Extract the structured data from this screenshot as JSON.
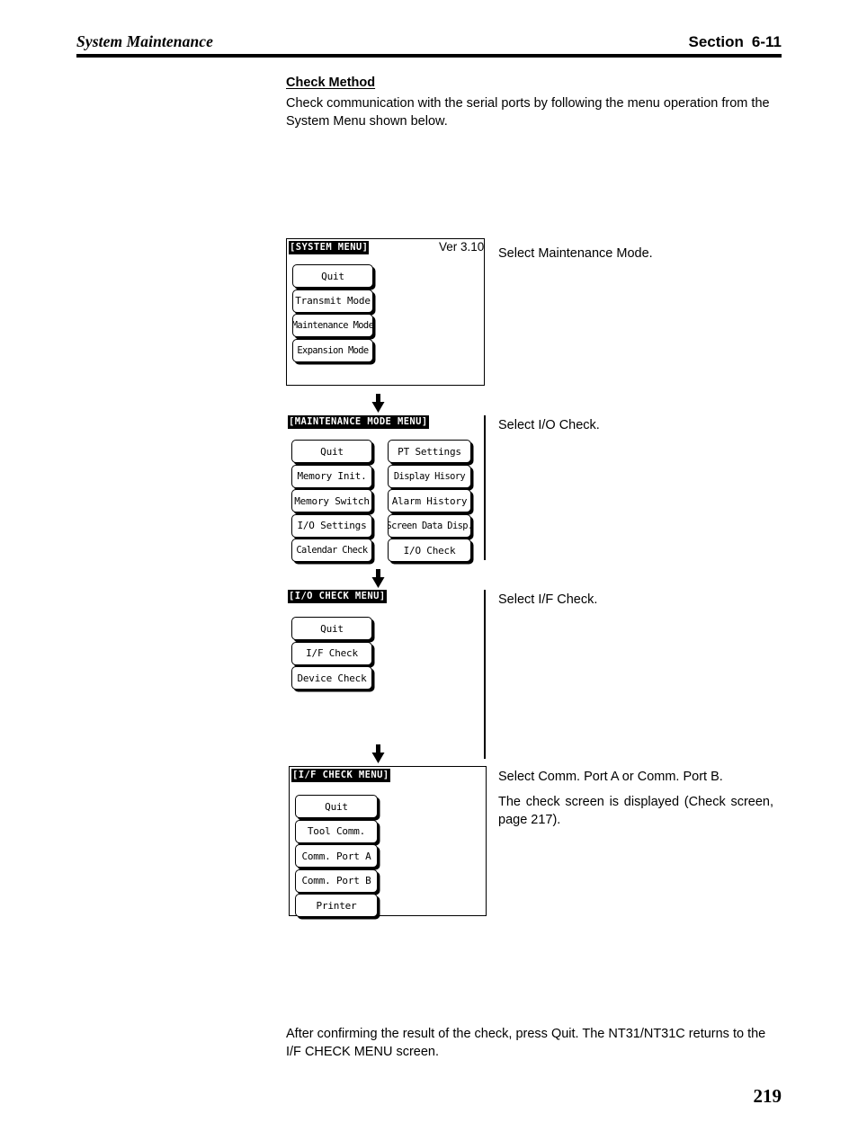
{
  "header": {
    "left_title": "System Maintenance",
    "section_word": "Section",
    "section_number": "6-11"
  },
  "intro": {
    "heading": "Check Method",
    "body": "Check communication with the serial ports by following the menu operation from the System Menu shown below."
  },
  "flow": {
    "arrow_icon": "down-arrow-icon",
    "screens": [
      {
        "id": "system-menu",
        "title": "[SYSTEM MENU]",
        "version": "Ver 3.10",
        "buttons_left": [
          "Quit",
          "Transmit Mode",
          "Maintenance Mode",
          "Expansion Mode"
        ],
        "buttons_right": [],
        "note_lines": [
          "Select Maintenance Mode."
        ]
      },
      {
        "id": "maintenance-mode-menu",
        "title": "[MAINTENANCE MODE MENU]",
        "version": "",
        "buttons_left": [
          "Quit",
          "Memory Init.",
          "Memory Switch",
          "I/O Settings",
          "Calendar Check"
        ],
        "buttons_right": [
          "PT Settings",
          "Display Hisory",
          "Alarm History",
          "Screen Data Disp.",
          "I/O Check"
        ],
        "note_lines": [
          "Select I/O Check."
        ]
      },
      {
        "id": "io-check-menu",
        "title": "[I/O CHECK MENU]",
        "version": "",
        "buttons_left": [
          "Quit",
          "I/F Check",
          "Device Check"
        ],
        "buttons_right": [],
        "note_lines": [
          "Select I/F Check."
        ]
      },
      {
        "id": "if-check-menu",
        "title": "[I/F CHECK MENU]",
        "version": "",
        "buttons_left": [
          "Quit",
          "Tool Comm.",
          "Comm. Port A",
          "Comm. Port B",
          "Printer"
        ],
        "buttons_right": [],
        "note_lines": [
          "Select Comm. Port A or Comm. Port B.",
          "The check screen is displayed (Check screen, page 217)."
        ]
      }
    ]
  },
  "closing": {
    "text": "After confirming the result of the check, press Quit. The NT31/NT31C returns to the I/F CHECK MENU screen."
  },
  "page_number": "219"
}
